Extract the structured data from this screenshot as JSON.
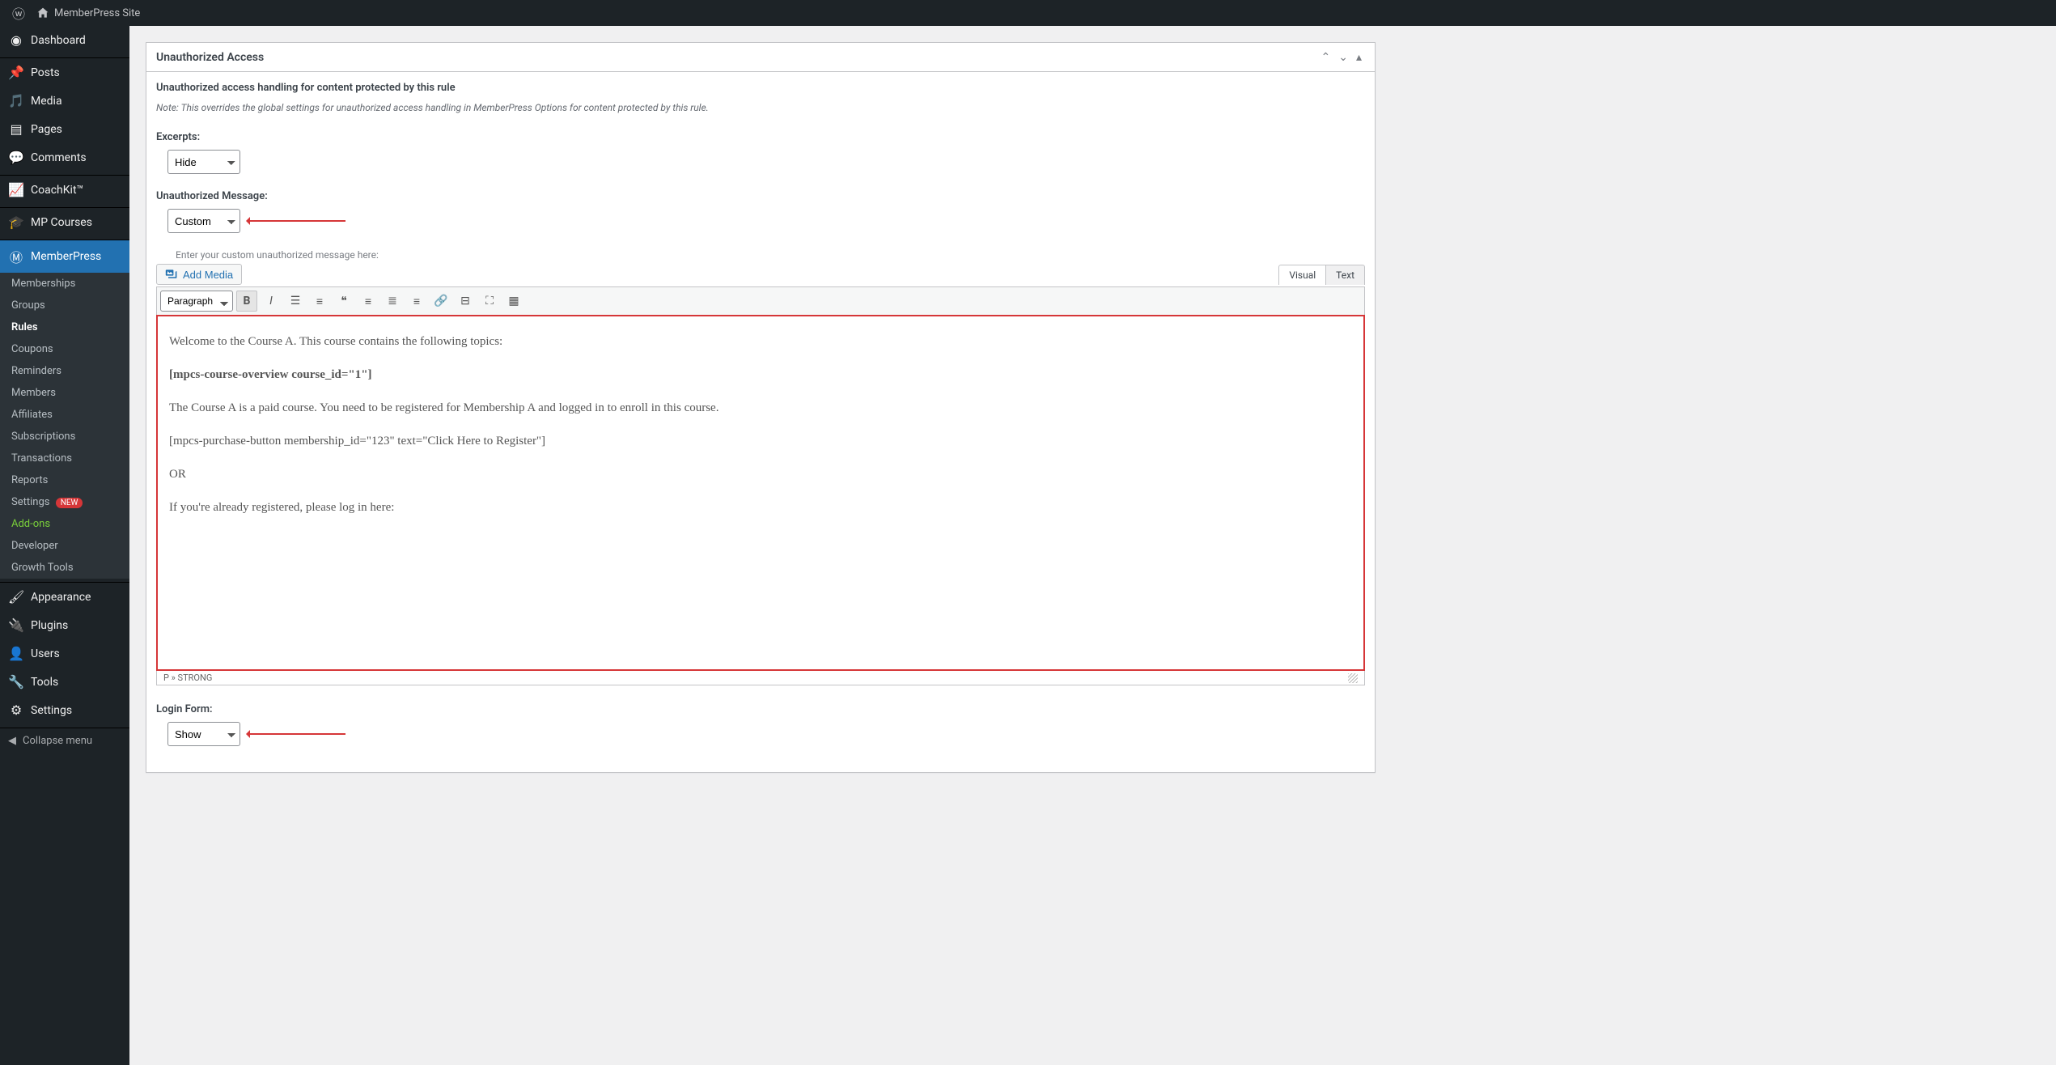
{
  "adminbar": {
    "site_name": "MemberPress Site"
  },
  "sidebar": {
    "items": [
      {
        "icon": "dashboard",
        "label": "Dashboard"
      },
      {
        "icon": "pin",
        "label": "Posts"
      },
      {
        "icon": "media",
        "label": "Media"
      },
      {
        "icon": "pages",
        "label": "Pages"
      },
      {
        "icon": "comments",
        "label": "Comments"
      },
      {
        "icon": "chart",
        "label": "CoachKit™"
      },
      {
        "icon": "grad",
        "label": "MP Courses"
      },
      {
        "icon": "mp",
        "label": "MemberPress",
        "active": true
      },
      {
        "icon": "appearance",
        "label": "Appearance"
      },
      {
        "icon": "plugins",
        "label": "Plugins"
      },
      {
        "icon": "users",
        "label": "Users"
      },
      {
        "icon": "tools",
        "label": "Tools"
      },
      {
        "icon": "settings",
        "label": "Settings"
      }
    ],
    "submenu": [
      {
        "label": "Memberships"
      },
      {
        "label": "Groups"
      },
      {
        "label": "Rules",
        "current": true
      },
      {
        "label": "Coupons"
      },
      {
        "label": "Reminders"
      },
      {
        "label": "Members"
      },
      {
        "label": "Affiliates"
      },
      {
        "label": "Subscriptions"
      },
      {
        "label": "Transactions"
      },
      {
        "label": "Reports"
      },
      {
        "label": "Settings",
        "badge": "NEW"
      },
      {
        "label": "Add-ons",
        "addons": true
      },
      {
        "label": "Developer"
      },
      {
        "label": "Growth Tools"
      }
    ],
    "collapse": "Collapse menu"
  },
  "panel": {
    "title": "Unauthorized Access",
    "subtitle": "Unauthorized access handling for content protected by this rule",
    "note": "Note: This overrides the global settings for unauthorized access handling in MemberPress Options for content protected by this rule.",
    "excerpts_label": "Excerpts:",
    "excerpts_value": "Hide",
    "unauth_label": "Unauthorized Message:",
    "unauth_value": "Custom",
    "login_label": "Login Form:",
    "login_value": "Show"
  },
  "editor": {
    "hint": "Enter your custom unauthorized message here:",
    "add_media": "Add Media",
    "tabs": {
      "visual": "Visual",
      "text": "Text"
    },
    "block_format": "Paragraph",
    "content": {
      "p1": "Welcome to the Course A. This course contains the following topics:",
      "p2": "[mpcs-course-overview course_id=\"1\"]",
      "p3": "The Course A is a paid course. You need to be registered for Membership A and logged in to enroll in this course.",
      "p4": "[mpcs-purchase-button membership_id=\"123\" text=\"Click Here to Register\"]",
      "p5": "OR",
      "p6": "If you're already registered, please log in here:"
    },
    "statusbar": "P » STRONG"
  }
}
